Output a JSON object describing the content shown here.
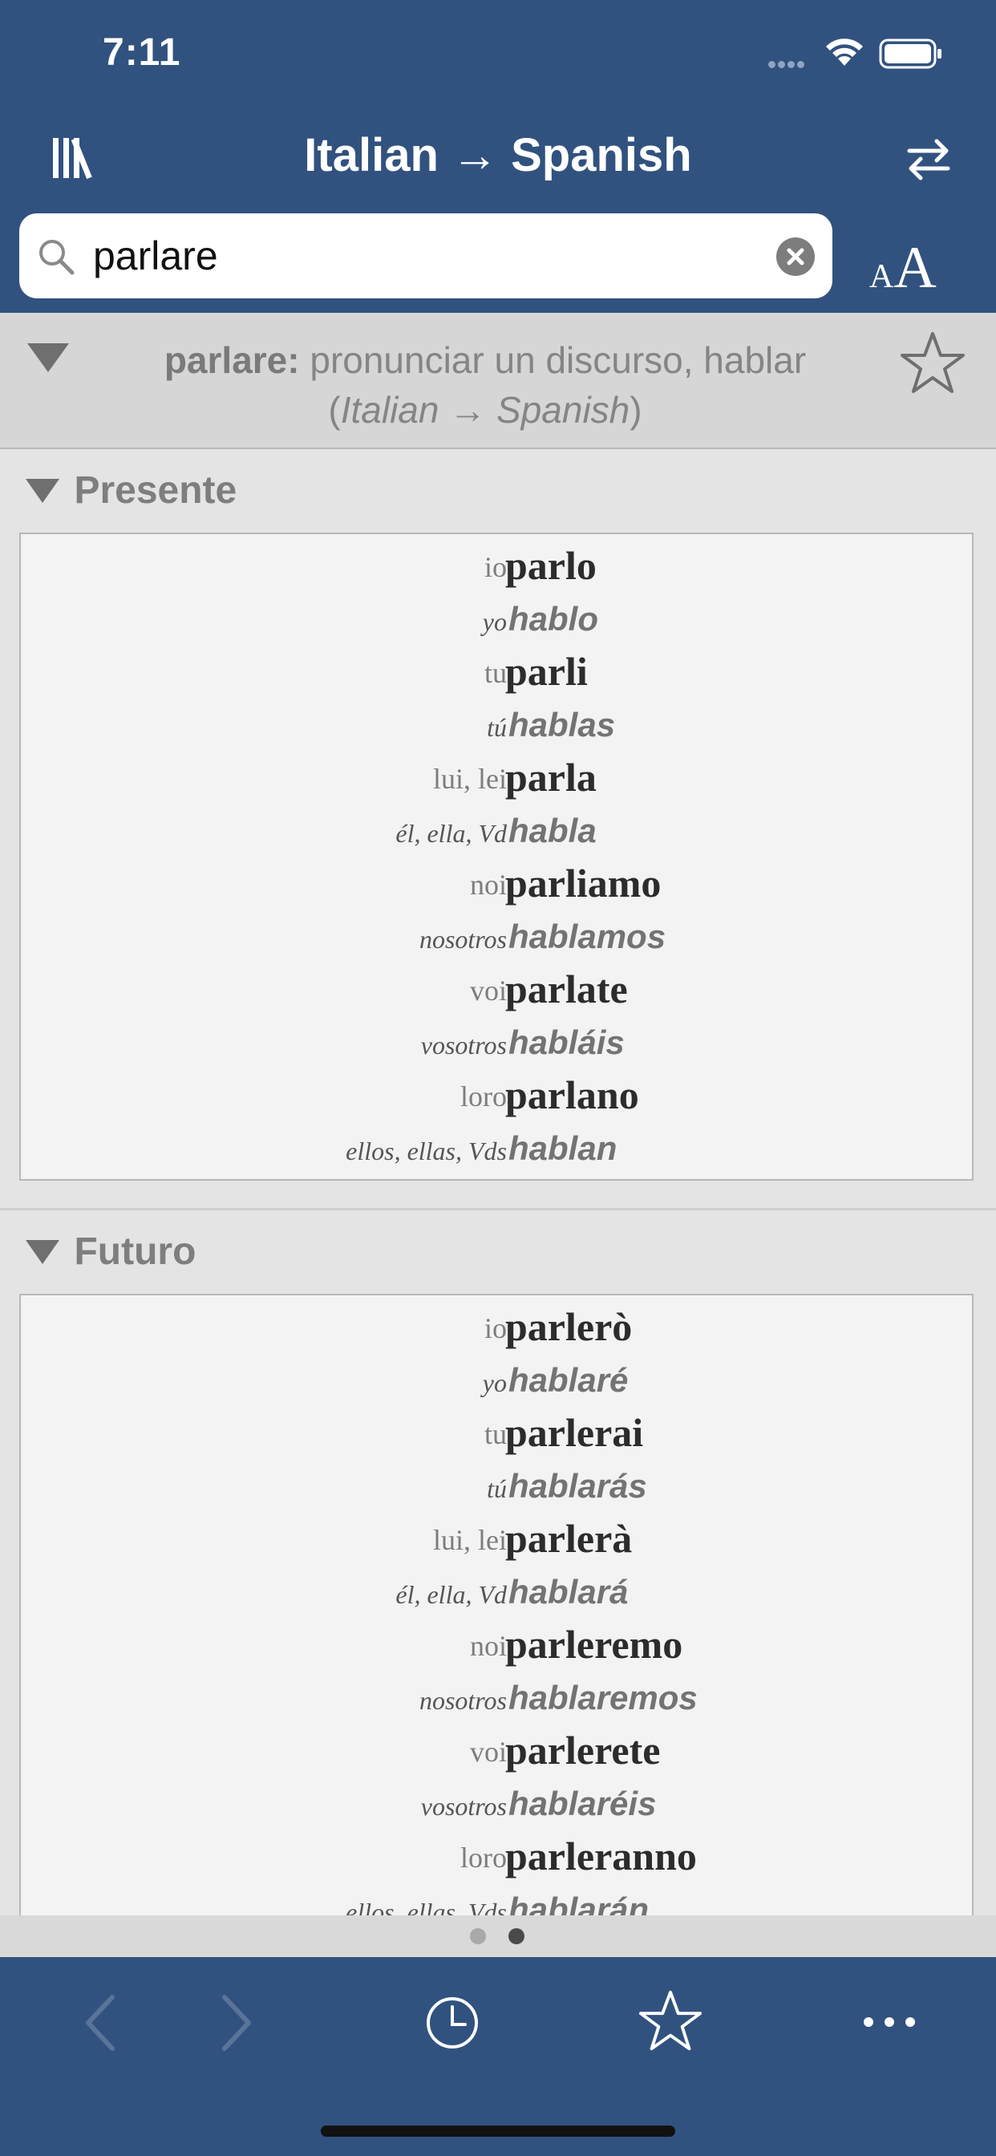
{
  "status_bar": {
    "time": "7:11"
  },
  "nav": {
    "title": "Italian → Spanish"
  },
  "search": {
    "value": "parlare",
    "placeholder": ""
  },
  "font_size_button": {
    "small": "A",
    "big": "A"
  },
  "entry": {
    "headword": "parlare:",
    "translation": " pronunciar un discurso, hablar",
    "direction_open": "(",
    "direction": "Italian → Spanish",
    "direction_close": ")"
  },
  "tenses": [
    {
      "name": "Presente",
      "rows": [
        {
          "it_pronoun": "io",
          "it_form": "parlo",
          "es_pronoun": "yo",
          "es_form": "hablo"
        },
        {
          "it_pronoun": "tu",
          "it_form": "parli",
          "es_pronoun": "tú",
          "es_form": "hablas"
        },
        {
          "it_pronoun": "lui, lei",
          "it_form": "parla",
          "es_pronoun": "él, ella, Vd",
          "es_form": "habla"
        },
        {
          "it_pronoun": "noi",
          "it_form": "parliamo",
          "es_pronoun": "nosotros",
          "es_form": "hablamos"
        },
        {
          "it_pronoun": "voi",
          "it_form": "parlate",
          "es_pronoun": "vosotros",
          "es_form": "habláis"
        },
        {
          "it_pronoun": "loro",
          "it_form": "parlano",
          "es_pronoun": "ellos, ellas, Vds",
          "es_form": "hablan"
        }
      ]
    },
    {
      "name": "Futuro",
      "rows": [
        {
          "it_pronoun": "io",
          "it_form": "parlerò",
          "es_pronoun": "yo",
          "es_form": "hablaré"
        },
        {
          "it_pronoun": "tu",
          "it_form": "parlerai",
          "es_pronoun": "tú",
          "es_form": "hablarás"
        },
        {
          "it_pronoun": "lui, lei",
          "it_form": "parlerà",
          "es_pronoun": "él, ella, Vd",
          "es_form": "hablará"
        },
        {
          "it_pronoun": "noi",
          "it_form": "parleremo",
          "es_pronoun": "nosotros",
          "es_form": "hablaremos"
        },
        {
          "it_pronoun": "voi",
          "it_form": "parlerete",
          "es_pronoun": "vosotros",
          "es_form": "hablaréis"
        },
        {
          "it_pronoun": "loro",
          "it_form": "parleranno",
          "es_pronoun": "ellos, ellas, Vds",
          "es_form": "hablarán"
        }
      ]
    }
  ],
  "pager": {
    "pages": 2,
    "current_page": 2
  },
  "toolbar": {
    "icons": [
      "back-arrow-icon",
      "forward-arrow-icon",
      "history-clock-icon",
      "favorites-star-icon",
      "more-ellipsis-icon"
    ]
  },
  "colors": {
    "bar_blue": "#31527f",
    "section_bg": "#e4e4e4",
    "table_bg": "#f3f3f3"
  }
}
